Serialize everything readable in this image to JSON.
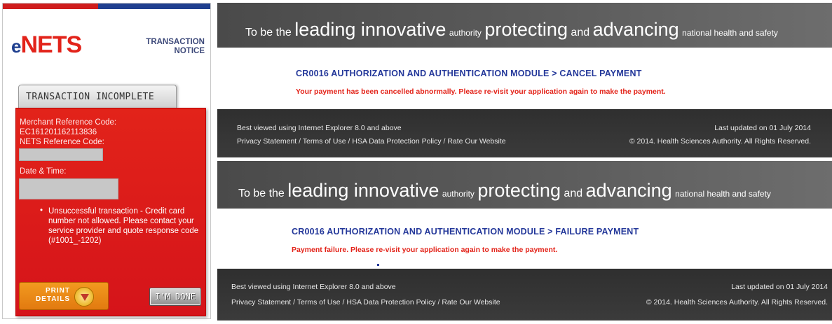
{
  "enets": {
    "logo_e": "e",
    "logo_nets": "NETS",
    "notice_line1": "TRANSACTION",
    "notice_line2": "NOTICE",
    "tab_label": "TRANSACTION INCOMPLETE",
    "merchant_label": "Merchant Reference Code:",
    "merchant_value": "EC161201162113836",
    "nets_ref_label": "NETS Reference Code:",
    "datetime_label": "Date & Time:",
    "bullet": "•",
    "error_message": "Unsuccessful transaction - Credit card number not allowed. Please contact your service provider and quote response code (#1001_-1202)",
    "print_label_1": "PRINT",
    "print_label_2": "DETAILS",
    "done_label": "I'M DONE",
    "colors": {
      "red": "#e2231a",
      "blue": "#1f3f8f",
      "orange": "#f29a1f"
    }
  },
  "hsa_cancel": {
    "banner": {
      "p1": "To be the",
      "p2": "leading innovative",
      "p3": "authority",
      "p4": "protecting",
      "p5": "and",
      "p6": "advancing",
      "p7": "national health and safety"
    },
    "module_title": "CR0016 AUTHORIZATION AND AUTHENTICATION MODULE > CANCEL PAYMENT",
    "message": "Your payment has been cancelled abnormally. Please re-visit your application again to make the payment.",
    "footer_left_1": "Best viewed using Internet Explorer 8.0 and above",
    "footer_left_2": "Privacy Statement / Terms of Use / HSA Data Protection Policy / Rate Our Website",
    "footer_right_1": "Last updated on 01 July 2014",
    "footer_right_2": "© 2014. Health Sciences Authority. All Rights Reserved."
  },
  "hsa_failure": {
    "banner": {
      "p1": "To be the",
      "p2": "leading innovative",
      "p3": "authority",
      "p4": "protecting",
      "p5": "and",
      "p6": "advancing",
      "p7": "national health and safety"
    },
    "module_title": "CR0016 AUTHORIZATION AND AUTHENTICATION MODULE > FAILURE PAYMENT",
    "message": "Payment failure. Please re-visit your application again to make the payment.",
    "footer_left_1": "Best viewed using Internet Explorer 8.0 and above",
    "footer_left_2": "Privacy Statement / Terms of Use / HSA Data Protection Policy / Rate Our Website",
    "footer_right_1": "Last updated on 01 July 2014",
    "footer_right_2": "© 2014. Health Sciences Authority. All Rights Reserved."
  }
}
